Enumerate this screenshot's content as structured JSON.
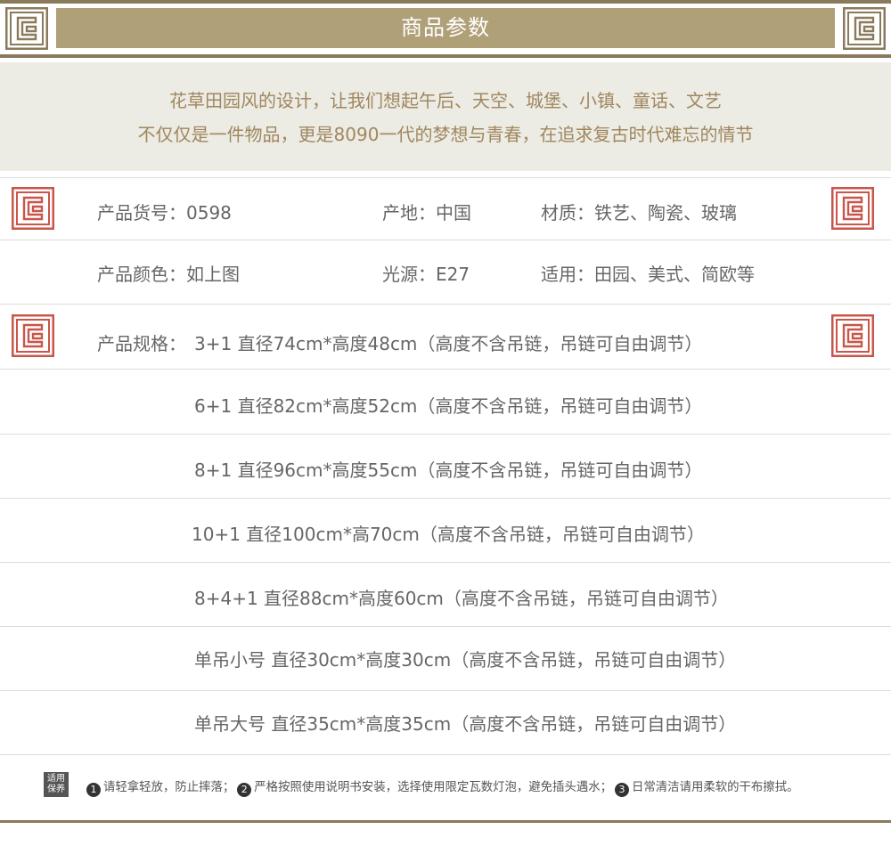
{
  "header": {
    "title": "商品参数"
  },
  "intro": {
    "line1": "花草田园风的设计，让我们想起午后、天空、城堡、小镇、童话、文艺",
    "line2": "不仅仅是一件物品，更是8090一代的梦想与青春，在追求复古时代难忘的情节"
  },
  "params": {
    "row1": {
      "item_no": "产品货号：0598",
      "origin": "产地：中国",
      "material": "材质：铁艺、陶瓷、玻璃"
    },
    "row2": {
      "color": "产品颜色：如上图",
      "light": "光源：E27",
      "usage": "适用：田园、美式、简欧等"
    }
  },
  "specs": {
    "label": "产品规格：",
    "items": [
      "3+1 直径74cm*高度48cm（高度不含吊链，吊链可自由调节）",
      "6+1 直径82cm*高度52cm（高度不含吊链，吊链可自由调节）",
      "8+1 直径96cm*高度55cm（高度不含吊链，吊链可自由调节）",
      "10+1 直径100cm*高70cm（高度不含吊链，吊链可自由调节）",
      "8+4+1 直径88cm*高度60cm（高度不含吊链，吊链可自由调节）",
      "单吊小号 直径30cm*高度30cm（高度不含吊链，吊链可自由调节）",
      "单吊大号 直径35cm*高度35cm（高度不含吊链，吊链可自由调节）"
    ]
  },
  "footer": {
    "badge_line1": "适用",
    "badge_line2": "保养",
    "n1": "1",
    "t1": "请轻拿轻放，防止摔落；",
    "n2": "2",
    "t2": "严格按照使用说明书安装，选择使用限定瓦数灯泡，避免插头遇水；",
    "n3": "3",
    "t3": "日常清洁请用柔软的干布擦拭。"
  },
  "colors": {
    "gold": "#b0a078",
    "frame": "#8a7a5c",
    "seal_red": "#c8564a",
    "intro_text": "#a0875e",
    "intro_bg": "#ecebe4"
  },
  "icons": {
    "corner": "meander-frame-icon",
    "seal": "meander-seal-icon"
  }
}
